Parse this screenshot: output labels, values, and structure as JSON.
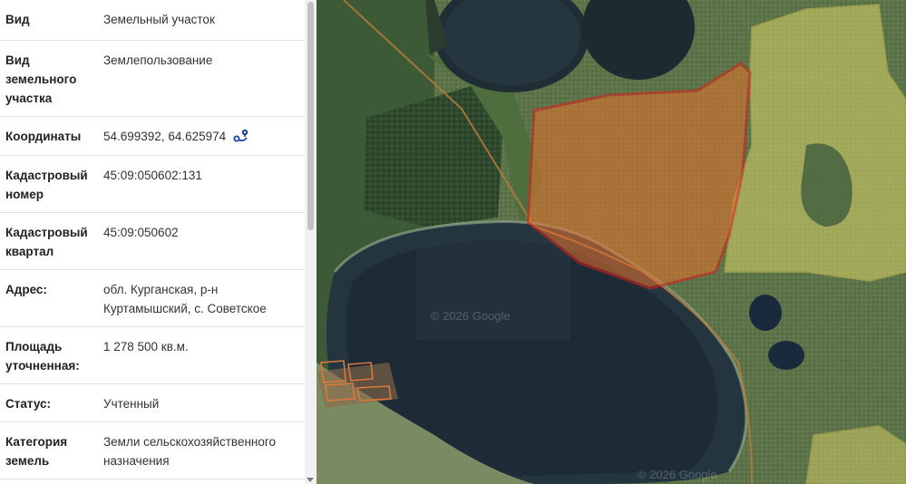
{
  "info_panel": {
    "rows": [
      {
        "label": "Вид",
        "value": "Земельный участок"
      },
      {
        "label": "Вид земельного участка",
        "value": "Землепользование"
      },
      {
        "label": "Координаты",
        "value": "54.699392, 64.625974"
      },
      {
        "label": "Кадастровый номер",
        "value": "45:09:050602:131"
      },
      {
        "label": "Кадастровый квартал",
        "value": "45:09:050602"
      },
      {
        "label": "Адрес:",
        "value": "обл. Курганская, р-н Куртамышский, с. Советское"
      },
      {
        "label": "Площадь уточненная:",
        "value": "1 278 500 кв.м."
      },
      {
        "label": "Статус:",
        "value": "Учтенный"
      },
      {
        "label": "Категория земель",
        "value": "Земли сельскохозяйственного назначения"
      }
    ]
  },
  "map": {
    "watermarks": [
      "© 2026 Google",
      "© 2026 Google"
    ],
    "parcel_highlight_color": "#e8732d",
    "parcel_border_color": "#e0201c",
    "neighbor_parcel_color": "#dcd56a",
    "coord_icon": "map-location-icon"
  }
}
